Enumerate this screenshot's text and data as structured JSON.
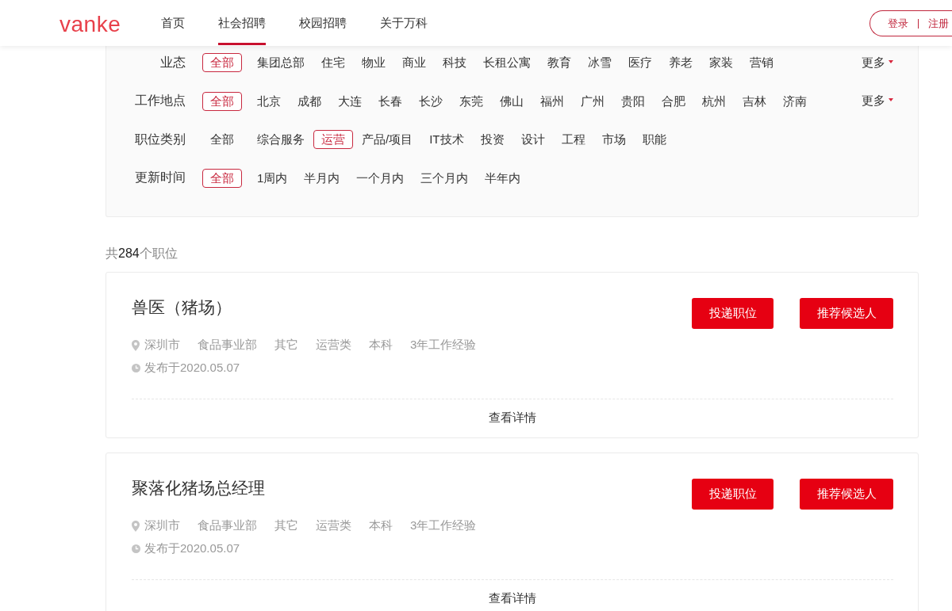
{
  "header": {
    "logo": "vanke",
    "nav": [
      {
        "label": "首页",
        "selected": false
      },
      {
        "label": "社会招聘",
        "selected": true
      },
      {
        "label": "校园招聘",
        "selected": false
      },
      {
        "label": "关于万科",
        "selected": false
      }
    ],
    "auth": {
      "login": "登录",
      "register": "注册"
    }
  },
  "filters": [
    {
      "label": "业态",
      "more": "更多",
      "options": [
        {
          "label": "全部",
          "selected": true
        },
        {
          "label": "集团总部",
          "selected": false
        },
        {
          "label": "住宅",
          "selected": false
        },
        {
          "label": "物业",
          "selected": false
        },
        {
          "label": "商业",
          "selected": false
        },
        {
          "label": "科技",
          "selected": false
        },
        {
          "label": "长租公寓",
          "selected": false
        },
        {
          "label": "教育",
          "selected": false
        },
        {
          "label": "冰雪",
          "selected": false
        },
        {
          "label": "医疗",
          "selected": false
        },
        {
          "label": "养老",
          "selected": false
        },
        {
          "label": "家装",
          "selected": false
        },
        {
          "label": "营销",
          "selected": false
        }
      ]
    },
    {
      "label": "工作地点",
      "more": "更多",
      "options": [
        {
          "label": "全部",
          "selected": true
        },
        {
          "label": "北京",
          "selected": false
        },
        {
          "label": "成都",
          "selected": false
        },
        {
          "label": "大连",
          "selected": false
        },
        {
          "label": "长春",
          "selected": false
        },
        {
          "label": "长沙",
          "selected": false
        },
        {
          "label": "东莞",
          "selected": false
        },
        {
          "label": "佛山",
          "selected": false
        },
        {
          "label": "福州",
          "selected": false
        },
        {
          "label": "广州",
          "selected": false
        },
        {
          "label": "贵阳",
          "selected": false
        },
        {
          "label": "合肥",
          "selected": false
        },
        {
          "label": "杭州",
          "selected": false
        },
        {
          "label": "吉林",
          "selected": false
        },
        {
          "label": "济南",
          "selected": false
        }
      ]
    },
    {
      "label": "职位类别",
      "options": [
        {
          "label": "全部",
          "selected": false
        },
        {
          "label": "综合服务",
          "selected": false
        },
        {
          "label": "运营",
          "selected": true
        },
        {
          "label": "产品/项目",
          "selected": false
        },
        {
          "label": "IT技术",
          "selected": false
        },
        {
          "label": "投资",
          "selected": false
        },
        {
          "label": "设计",
          "selected": false
        },
        {
          "label": "工程",
          "selected": false
        },
        {
          "label": "市场",
          "selected": false
        },
        {
          "label": "职能",
          "selected": false
        }
      ]
    },
    {
      "label": "更新时间",
      "options": [
        {
          "label": "全部",
          "selected": true
        },
        {
          "label": "1周内",
          "selected": false
        },
        {
          "label": "半月内",
          "selected": false
        },
        {
          "label": "一个月内",
          "selected": false
        },
        {
          "label": "三个月内",
          "selected": false
        },
        {
          "label": "半年内",
          "selected": false
        }
      ]
    }
  ],
  "total": "共**284**个职位",
  "jobs": [
    {
      "title": "兽医（猪场）",
      "location": "深圳市",
      "attributes": [
        "食品事业部",
        "其它",
        "运营类",
        "本科",
        "3年工作经验"
      ],
      "published": "发布于2020.05.07",
      "actions": [
        "投递职位",
        "推荐候选人"
      ],
      "details": "查看详情"
    },
    {
      "title": "聚落化猪场总经理",
      "location": "深圳市",
      "attributes": [
        "食品事业部",
        "其它",
        "运营类",
        "本科",
        "3年工作经验"
      ],
      "published": "发布于2020.05.07",
      "actions": [
        "投递职位",
        "推荐候选人"
      ],
      "details": "查看详情"
    }
  ]
}
